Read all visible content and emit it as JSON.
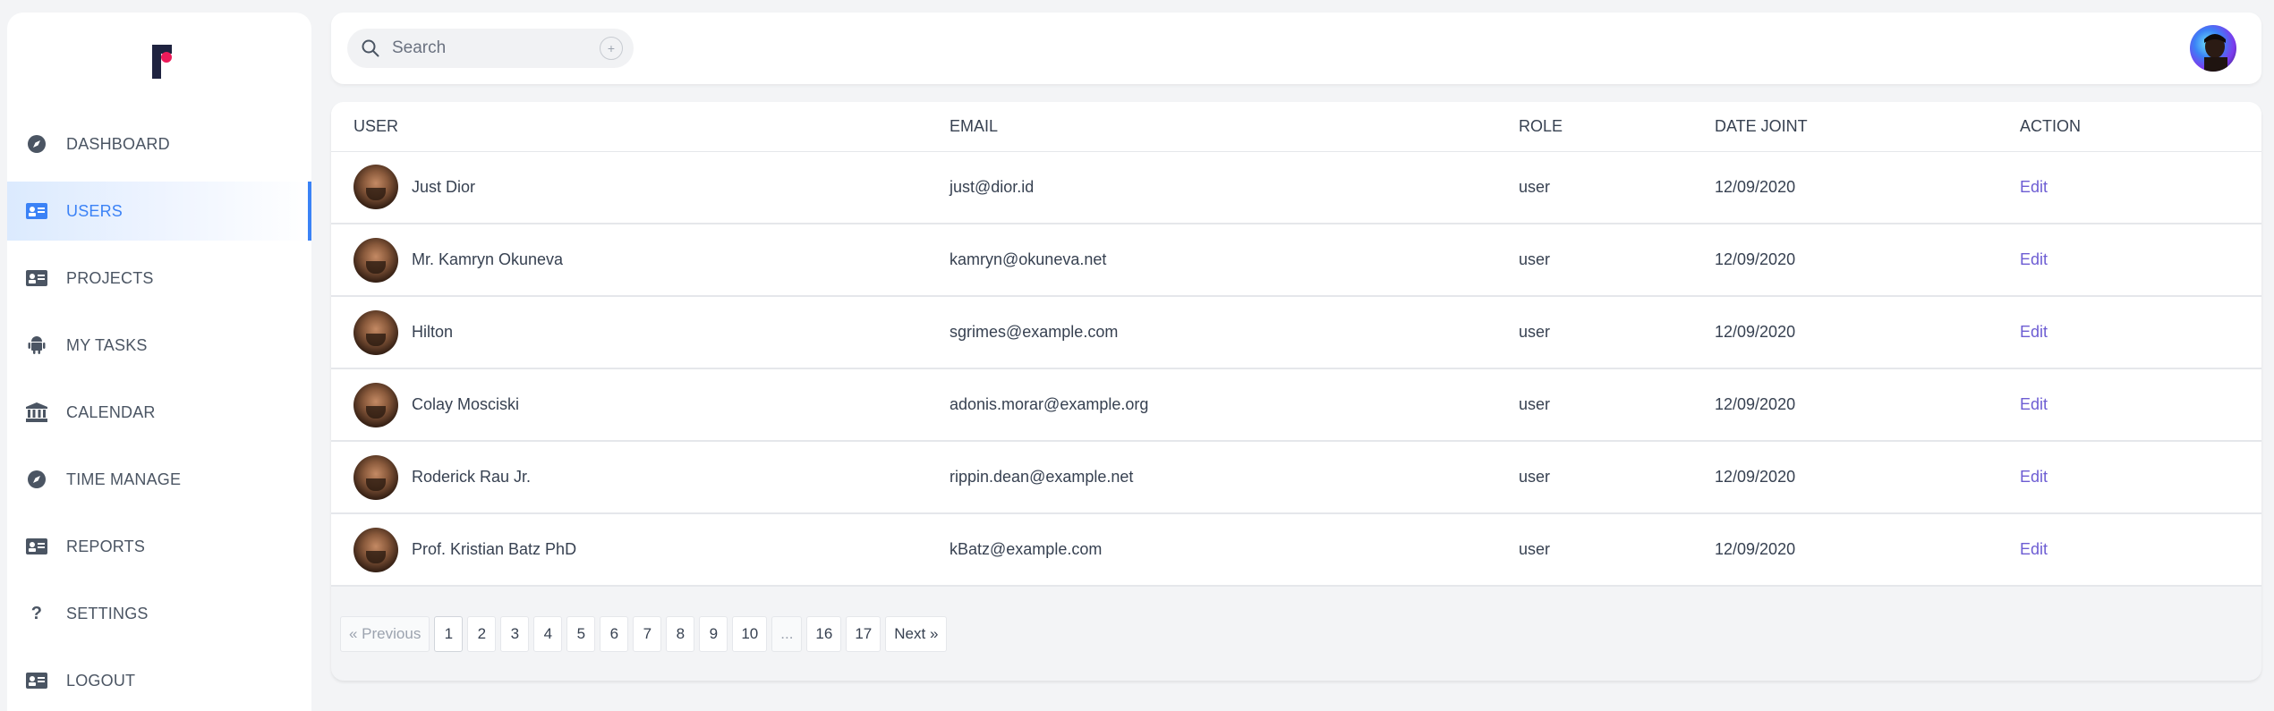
{
  "sidebar": {
    "items": [
      {
        "label": "DASHBOARD",
        "icon": "compass-icon"
      },
      {
        "label": "USERS",
        "icon": "id-card-icon",
        "active": true
      },
      {
        "label": "PROJECTS",
        "icon": "id-card-icon"
      },
      {
        "label": "MY TASKS",
        "icon": "android-icon"
      },
      {
        "label": "CALENDAR",
        "icon": "bank-icon"
      },
      {
        "label": "TIME MANAGE",
        "icon": "compass-icon"
      },
      {
        "label": "REPORTS",
        "icon": "id-card-icon"
      },
      {
        "label": "SETTINGS",
        "icon": "question-icon"
      },
      {
        "label": "LOGOUT",
        "icon": "id-card-icon"
      }
    ]
  },
  "header": {
    "search_placeholder": "Search",
    "search_add_label": "+"
  },
  "table": {
    "columns": [
      "USER",
      "EMAIL",
      "ROLE",
      "DATE JOINT",
      "ACTION"
    ],
    "rows": [
      {
        "name": "Just Dior",
        "email": "just@dior.id",
        "role": "user",
        "date": "12/09/2020",
        "action": "Edit"
      },
      {
        "name": "Mr. Kamryn Okuneva",
        "email": "kamryn@okuneva.net",
        "role": "user",
        "date": "12/09/2020",
        "action": "Edit"
      },
      {
        "name": "Hilton",
        "email": "sgrimes@example.com",
        "role": "user",
        "date": "12/09/2020",
        "action": "Edit"
      },
      {
        "name": "Colay Mosciski",
        "email": "adonis.morar@example.org",
        "role": "user",
        "date": "12/09/2020",
        "action": "Edit"
      },
      {
        "name": "Roderick Rau Jr.",
        "email": "rippin.dean@example.net",
        "role": "user",
        "date": "12/09/2020",
        "action": "Edit"
      },
      {
        "name": "Prof. Kristian Batz PhD",
        "email": "kBatz@example.com",
        "role": "user",
        "date": "12/09/2020",
        "action": "Edit"
      }
    ]
  },
  "pagination": {
    "previous": "« Previous",
    "pages": [
      "1",
      "2",
      "3",
      "4",
      "5",
      "6",
      "7",
      "8",
      "9",
      "10",
      "...",
      "16",
      "17"
    ],
    "current": "1",
    "next": "Next »"
  },
  "colors": {
    "accent": "#3b82f6",
    "link": "#6d5dd3",
    "logo_dark": "#1f2340",
    "logo_pink": "#ec1b5a"
  }
}
